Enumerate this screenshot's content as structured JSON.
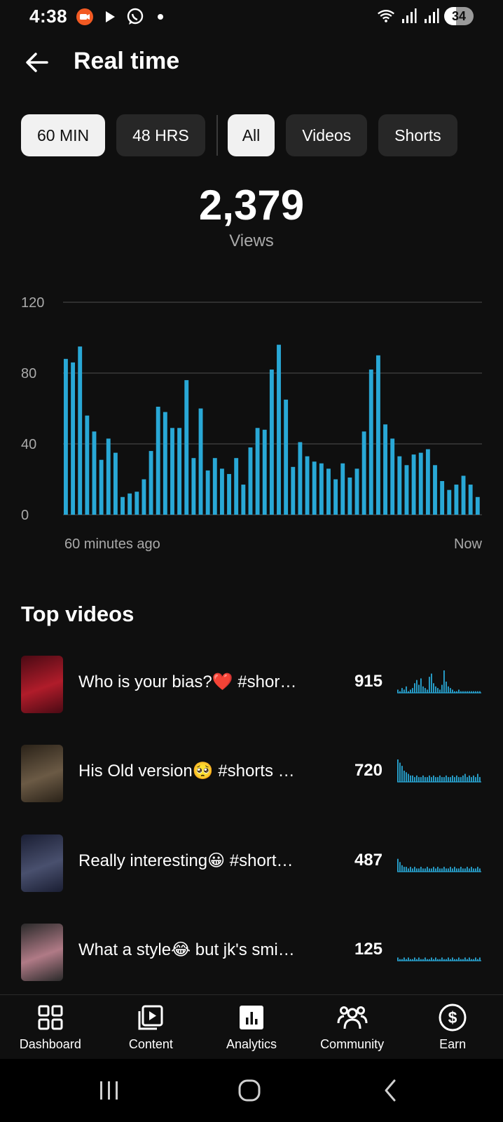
{
  "status_bar": {
    "time": "4:38",
    "battery": "34",
    "icons_left": [
      "screen-recorder-icon",
      "play-store-icon",
      "whatsapp-icon",
      "dot-icon"
    ],
    "icons_right": [
      "wifi-icon",
      "signal-icon",
      "signal-icon",
      "battery-icon"
    ]
  },
  "header": {
    "title": "Real time",
    "back_icon": "arrow-left-icon"
  },
  "filters": {
    "time_range": [
      {
        "label": "60 MIN",
        "active": true
      },
      {
        "label": "48 HRS",
        "active": false
      }
    ],
    "content_type": [
      {
        "label": "All",
        "active": true
      },
      {
        "label": "Videos",
        "active": false
      },
      {
        "label": "Shorts",
        "active": false
      }
    ]
  },
  "summary": {
    "value": "2,379",
    "label": "Views"
  },
  "chart_data": {
    "type": "bar",
    "x_start_label": "60 minutes ago",
    "x_end_label": "Now",
    "yticks": [
      "0",
      "40",
      "80",
      "120"
    ],
    "ylim": [
      0,
      120
    ],
    "grid": true,
    "color": "#29a8d6",
    "values": [
      88,
      86,
      95,
      56,
      47,
      31,
      43,
      35,
      10,
      12,
      13,
      20,
      36,
      61,
      58,
      49,
      49,
      76,
      32,
      60,
      25,
      32,
      26,
      23,
      32,
      17,
      38,
      49,
      48,
      82,
      96,
      65,
      27,
      41,
      33,
      30,
      29,
      26,
      20,
      29,
      21,
      26,
      47,
      82,
      90,
      51,
      43,
      33,
      28,
      34,
      35,
      37,
      28,
      19,
      14,
      17,
      22,
      17,
      10
    ]
  },
  "top_videos": {
    "title": "Top videos",
    "items": [
      {
        "title": "Who is your bias?❤️ #shor…",
        "views": "915",
        "thumb_colors": [
          "#4a0a14",
          "#b01c2a"
        ],
        "spark": [
          2,
          1,
          3,
          2,
          4,
          1,
          2,
          3,
          6,
          8,
          5,
          9,
          4,
          3,
          2,
          10,
          12,
          6,
          4,
          3,
          2,
          5,
          14,
          7,
          4,
          3,
          2,
          1,
          1,
          2,
          1,
          1,
          1,
          1,
          1,
          1,
          1,
          1,
          1,
          1
        ]
      },
      {
        "title": "His Old version🥺 #shorts …",
        "views": "720",
        "thumb_colors": [
          "#2a2218",
          "#6b5a45"
        ],
        "spark": [
          14,
          12,
          10,
          7,
          6,
          5,
          4,
          4,
          3,
          4,
          3,
          3,
          4,
          3,
          3,
          4,
          3,
          4,
          3,
          3,
          4,
          3,
          3,
          4,
          3,
          3,
          4,
          3,
          4,
          3,
          3,
          4,
          5,
          3,
          4,
          3,
          4,
          3,
          5,
          3
        ]
      },
      {
        "title": "Really interesting😀 #short…",
        "views": "487",
        "thumb_colors": [
          "#1a1e33",
          "#49506e"
        ],
        "spark": [
          8,
          6,
          4,
          3,
          3,
          2,
          3,
          2,
          3,
          2,
          2,
          3,
          2,
          2,
          3,
          2,
          2,
          3,
          2,
          3,
          2,
          2,
          3,
          2,
          2,
          3,
          2,
          3,
          2,
          2,
          3,
          2,
          2,
          3,
          2,
          3,
          2,
          2,
          3,
          2
        ]
      },
      {
        "title": "What a style😂 but jk's smi…",
        "views": "125",
        "thumb_colors": [
          "#2a2a2a",
          "#b07a86"
        ],
        "spark": [
          2,
          1,
          1,
          2,
          1,
          2,
          1,
          1,
          2,
          1,
          2,
          1,
          1,
          2,
          1,
          1,
          2,
          1,
          2,
          1,
          1,
          2,
          1,
          1,
          2,
          1,
          2,
          1,
          1,
          2,
          1,
          1,
          2,
          1,
          2,
          1,
          1,
          2,
          1,
          2
        ]
      }
    ]
  },
  "bottom_nav": [
    {
      "label": "Dashboard",
      "icon": "dashboard-icon"
    },
    {
      "label": "Content",
      "icon": "content-icon"
    },
    {
      "label": "Analytics",
      "icon": "analytics-icon",
      "active": true
    },
    {
      "label": "Community",
      "icon": "community-icon"
    },
    {
      "label": "Earn",
      "icon": "earn-icon"
    }
  ],
  "system_nav": [
    "recents-icon",
    "home-icon",
    "back-icon"
  ]
}
